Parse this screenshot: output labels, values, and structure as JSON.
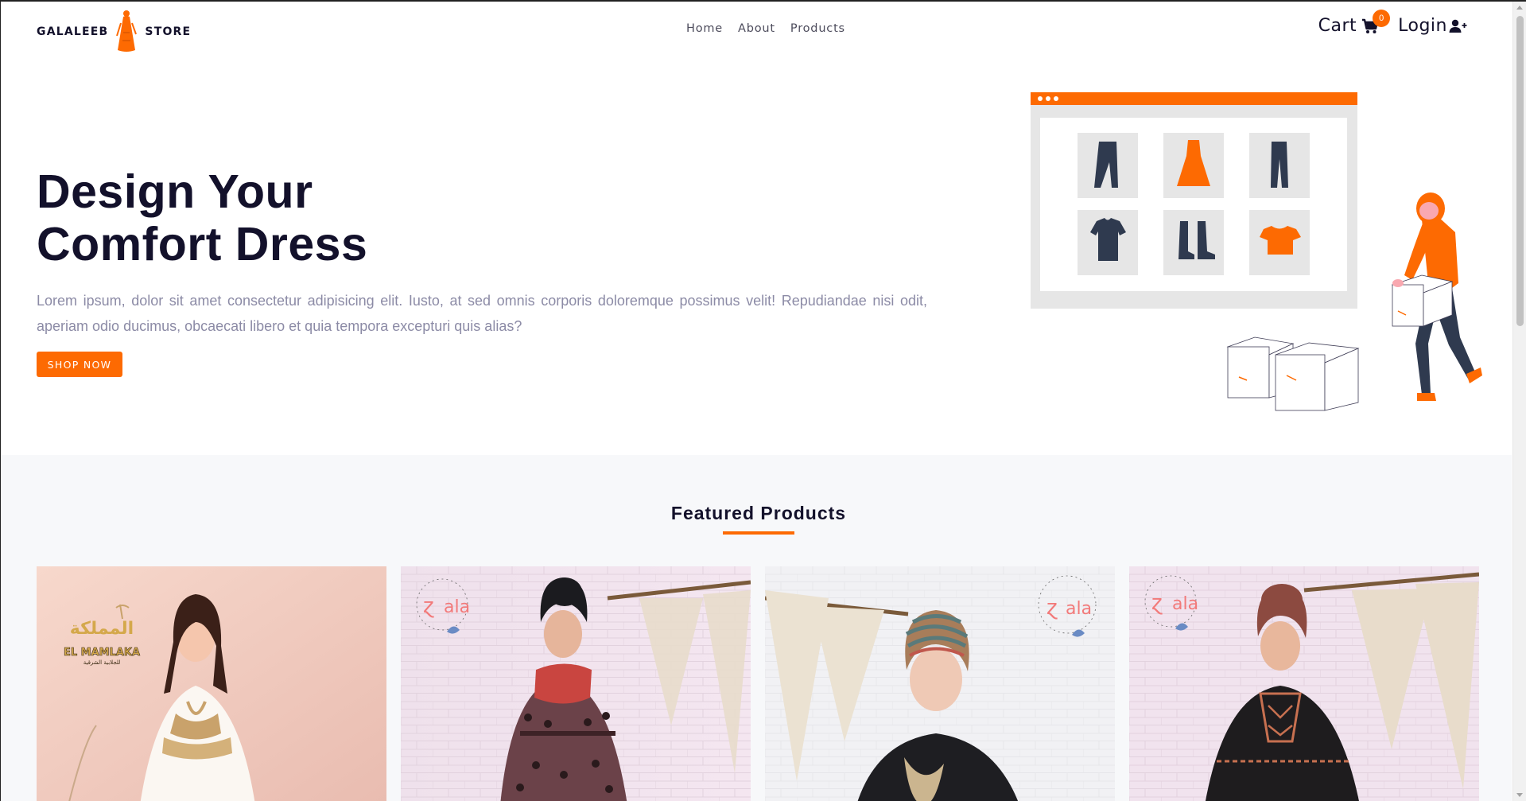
{
  "brand": {
    "left": "GALALEEB",
    "right": "STORE",
    "logo_icon": "woman-dress-logo-icon"
  },
  "nav": {
    "links": [
      "Home",
      "About",
      "Products"
    ]
  },
  "cart": {
    "label": "Cart",
    "count": "0",
    "icon": "cart-icon"
  },
  "login": {
    "label": "Login",
    "icon": "user-plus-icon"
  },
  "hero": {
    "title_line1": "Design Your",
    "title_line2": "Comfort Dress",
    "text": "Lorem ipsum, dolor sit amet consectetur adipisicing elit. Iusto, at sed omnis corporis doloremque possimus velit! Repudiandae nisi odit, aperiam odio ducimus, obcaecati libero et quia tempora excepturi quis alias?",
    "button": "SHOP NOW"
  },
  "featured": {
    "title": "Featured Products",
    "products": [
      {
        "logo_text": "EL MAMLAKA"
      },
      {
        "logo_text": "ala"
      },
      {
        "logo_text": "ala"
      },
      {
        "logo_text": "ala"
      }
    ]
  },
  "colors": {
    "accent": "#fd6a02",
    "dark": "#13112b",
    "muted": "#8c8ba6"
  }
}
